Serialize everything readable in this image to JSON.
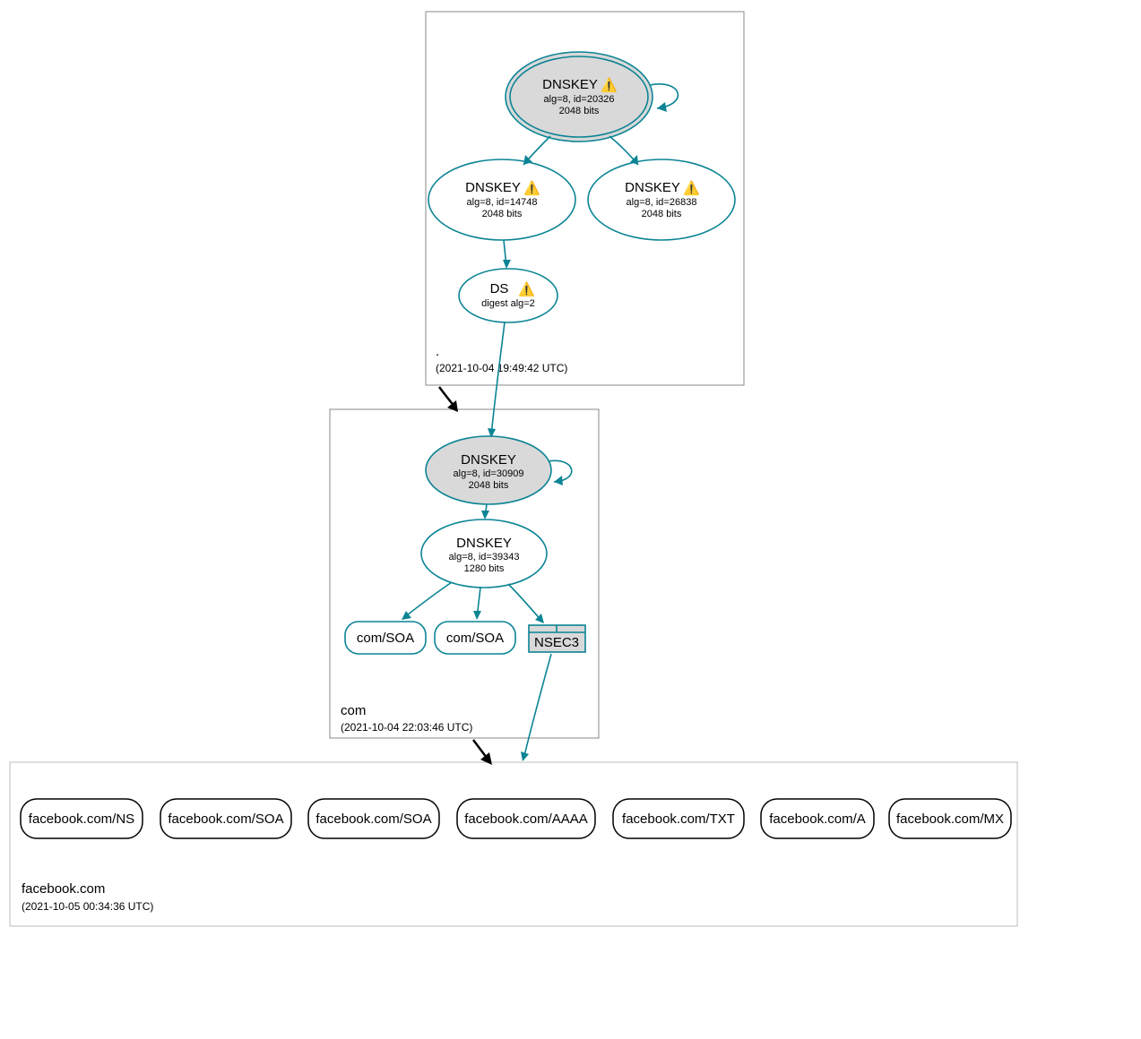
{
  "colors": {
    "teal": "#0b8494",
    "nodeGrey": "#d9d9d9"
  },
  "warnIcon": "⚠️",
  "zones": {
    "root": {
      "name": ".",
      "timestamp": "(2021-10-04 19:49:42 UTC)",
      "nodes": {
        "ksk": {
          "title": "DNSKEY",
          "warn": true,
          "line2": "alg=8, id=20326",
          "line3": "2048 bits"
        },
        "zskA": {
          "title": "DNSKEY",
          "warn": true,
          "line2": "alg=8, id=14748",
          "line3": "2048 bits"
        },
        "zskB": {
          "title": "DNSKEY",
          "warn": true,
          "line2": "alg=8, id=26838",
          "line3": "2048 bits"
        },
        "ds": {
          "title": "DS",
          "warn": true,
          "line2": "digest alg=2"
        }
      }
    },
    "com": {
      "name": "com",
      "timestamp": "(2021-10-04 22:03:46 UTC)",
      "nodes": {
        "ksk": {
          "title": "DNSKEY",
          "warn": false,
          "line2": "alg=8, id=30909",
          "line3": "2048 bits"
        },
        "zsk": {
          "title": "DNSKEY",
          "warn": false,
          "line2": "alg=8, id=39343",
          "line3": "1280 bits"
        },
        "soa1": {
          "label": "com/SOA"
        },
        "soa2": {
          "label": "com/SOA"
        },
        "nsec3": {
          "label": "NSEC3"
        }
      }
    },
    "facebook": {
      "name": "facebook.com",
      "timestamp": "(2021-10-05 00:34:36 UTC)",
      "records": [
        "facebook.com/NS",
        "facebook.com/SOA",
        "facebook.com/SOA",
        "facebook.com/AAAA",
        "facebook.com/TXT",
        "facebook.com/A",
        "facebook.com/MX"
      ]
    }
  }
}
